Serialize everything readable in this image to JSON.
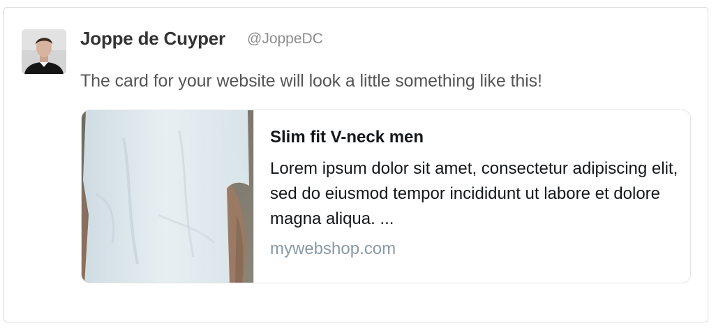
{
  "tweet": {
    "author_name": "Joppe de Cuyper",
    "author_handle": "@JoppeDC",
    "text": "The card for your website will look a little something like this!"
  },
  "card": {
    "title": "Slim fit V-neck men",
    "description": "Lorem ipsum dolor sit amet, consectetur adipiscing elit, sed do eiusmod tempor incididunt ut labore et dolore magna aliqua. ...",
    "domain": "mywebshop.com",
    "image_icon": "product-photo-tshirt"
  },
  "colors": {
    "name": "#333333",
    "handle": "#8c8c8c",
    "tweet_text": "#555555",
    "card_title": "#14171a",
    "card_domain": "#8899a6",
    "border": "#d8dbdf"
  }
}
